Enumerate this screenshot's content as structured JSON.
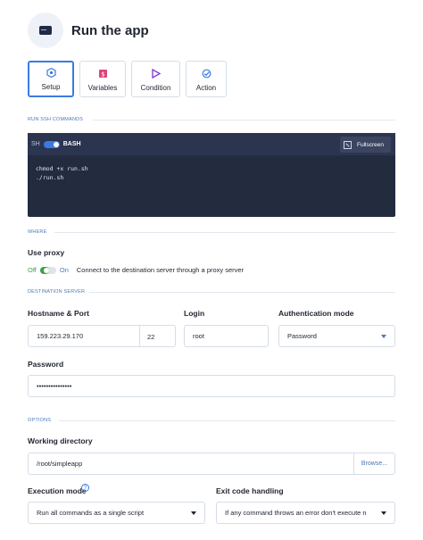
{
  "header": {
    "title": "Run the app"
  },
  "tabs": [
    {
      "label": "Setup",
      "icon": "setup-icon",
      "active": true
    },
    {
      "label": "Variables",
      "icon": "variables-icon",
      "active": false
    },
    {
      "label": "Condition",
      "icon": "condition-icon",
      "active": false
    },
    {
      "label": "Action",
      "icon": "action-icon",
      "active": false
    }
  ],
  "sections": {
    "commands": "RUN SSH COMMANDS",
    "where": "WHERE",
    "destination": "DESTINATION SERVER",
    "options": "OPTIONS"
  },
  "code_editor": {
    "sh_label": "SH",
    "bash_label": "BASH",
    "fullscreen_label": "Fullscreen",
    "lines": [
      "chmod +x run.sh",
      "./run.sh"
    ]
  },
  "proxy": {
    "label": "Use proxy",
    "off_label": "Off",
    "on_label": "On",
    "description": "Connect to the destination server through a proxy server",
    "enabled": false
  },
  "destination": {
    "hostname_label": "Hostname & Port",
    "hostname_value": "159.223.29.170",
    "port_value": "22",
    "login_label": "Login",
    "login_value": "root",
    "auth_label": "Authentication mode",
    "auth_value": "Password",
    "password_label": "Password",
    "password_value": "•••••••••••••••"
  },
  "options": {
    "workdir_label": "Working directory",
    "workdir_value": "/root/simpleapp",
    "browse_label": "Browse...",
    "exec_mode_label": "Execution mode",
    "exec_mode_value": "Run all commands as a single script",
    "exit_label": "Exit code handling",
    "exit_value": "If any command throws an error don't execute n"
  },
  "colors": {
    "accent": "#3b7ae0",
    "editor_bg": "#232b3f",
    "proxy_off_green": "#3aa24b"
  }
}
